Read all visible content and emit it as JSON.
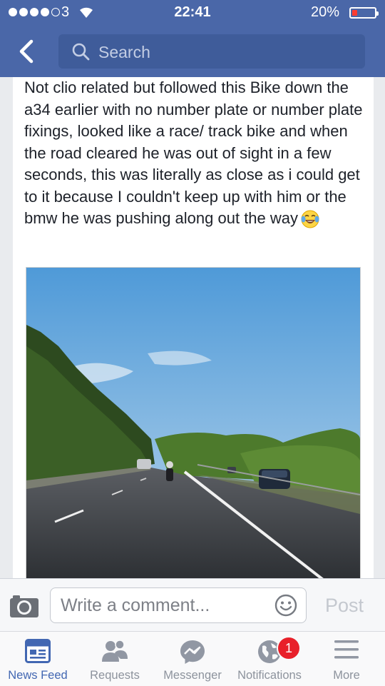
{
  "status_bar": {
    "carrier": "3",
    "time": "22:41",
    "battery": "20%"
  },
  "header": {
    "search_placeholder": "Search"
  },
  "post": {
    "text": "Not clio related  but followed this Bike down the a34 earlier with no number plate or number plate fixings, looked like a race/ track bike and when the road cleared he was out of sight in a few seconds, this was literally as close as i could get to it because I couldn't keep up with him or the bmw he was pushing along out the way",
    "emoji": "tears-of-joy-emoji"
  },
  "comment_bar": {
    "placeholder": "Write a comment...",
    "post_label": "Post"
  },
  "tabs": [
    {
      "label": "News Feed",
      "icon": "news-feed-icon",
      "active": true
    },
    {
      "label": "Requests",
      "icon": "friend-requests-icon"
    },
    {
      "label": "Messenger",
      "icon": "messenger-icon"
    },
    {
      "label": "Notifications",
      "icon": "globe-icon",
      "badge": "1"
    },
    {
      "label": "More",
      "icon": "menu-icon"
    }
  ],
  "colors": {
    "header": "#4a67a8",
    "active_tab": "#4267b2",
    "badge": "#e8202a"
  }
}
